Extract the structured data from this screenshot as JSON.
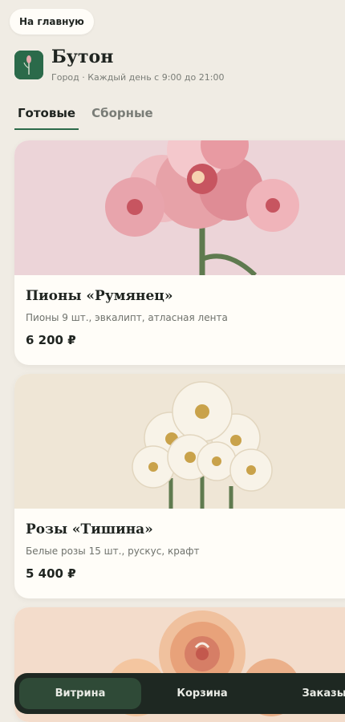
{
  "header": {
    "home_button": "На главную",
    "shop_name": "Бутон",
    "shop_subtitle": "Город · Каждый день с 9:00 до 21:00"
  },
  "tabs": [
    {
      "label": "Готовые",
      "active": true
    },
    {
      "label": "Сборные",
      "active": false
    }
  ],
  "products": [
    {
      "name": "Пионы «Румянец»",
      "description": "Пионы 9 шт., эвкалипт, атласная лента",
      "price": "6 200 ₽",
      "bg_color": "#ecd4d8"
    },
    {
      "name": "Розы «Тишина»",
      "description": "Белые розы 15 шт., рускус, крафт",
      "price": "5 400 ₽",
      "bg_color": "#efe6d6"
    },
    {
      "bg_color": "#f3dccb"
    }
  ],
  "bottom_nav": [
    {
      "label": "Витрина",
      "active": true
    },
    {
      "label": "Корзина",
      "active": false
    },
    {
      "label": "Заказы",
      "active": false
    }
  ],
  "colors": {
    "accent": "#2b6a4a",
    "nav_bg": "#1e2822",
    "nav_active": "#2f4a37"
  }
}
